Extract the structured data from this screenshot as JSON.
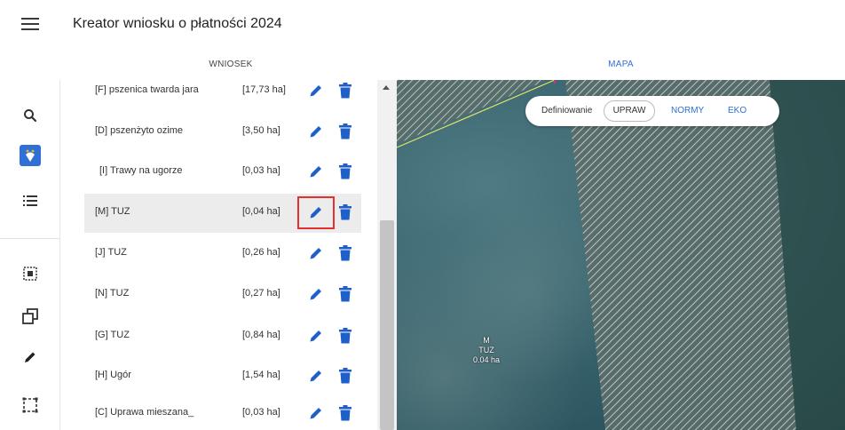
{
  "header": {
    "title": "Kreator wniosku o płatności 2024",
    "menu_icon": "hamburger-icon"
  },
  "tabs": [
    {
      "label": "WNIOSEK",
      "active": true
    },
    {
      "label": "MAPA",
      "active": false
    }
  ],
  "toolbar": {
    "items": [
      {
        "icon": "search-icon"
      },
      {
        "icon": "crop-marker-icon",
        "active": true
      },
      {
        "icon": "list-icon"
      },
      {
        "icon": "select-object-icon"
      },
      {
        "icon": "copy-icon"
      },
      {
        "icon": "pencil-icon"
      },
      {
        "icon": "select-area-icon"
      }
    ]
  },
  "parcels": [
    {
      "name": "[F] pszenica twarda jara",
      "area": "[17,73 ha]"
    },
    {
      "name": "[D] pszenżyto ozime",
      "area": "[3,50 ha]"
    },
    {
      "name": "[I] Trawy na ugorze",
      "area": "[0,03 ha]"
    },
    {
      "name": "[M] TUZ",
      "area": "[0,04 ha]",
      "selected": true
    },
    {
      "name": "[J] TUZ",
      "area": "[0,26 ha]"
    },
    {
      "name": "[N] TUZ",
      "area": "[0,27 ha]"
    },
    {
      "name": "[G] TUZ",
      "area": "[0,84 ha]"
    },
    {
      "name": "[H] Ugór",
      "area": "[1,54 ha]"
    },
    {
      "name": "[C] Uprawa mieszana_",
      "area": "[0,03 ha]"
    }
  ],
  "map": {
    "mode_label": "Definiowanie",
    "modes": [
      "UPRAW",
      "NORMY",
      "EKO"
    ],
    "active_mode": "UPRAW",
    "parcel_label": {
      "letter": "M",
      "crop": "TUZ",
      "area": "0.04 ha"
    }
  },
  "colors": {
    "accent": "#2f6fd6",
    "highlight": "#e53030",
    "icon": "#1f5fc8",
    "selected_row": "#ececec"
  }
}
